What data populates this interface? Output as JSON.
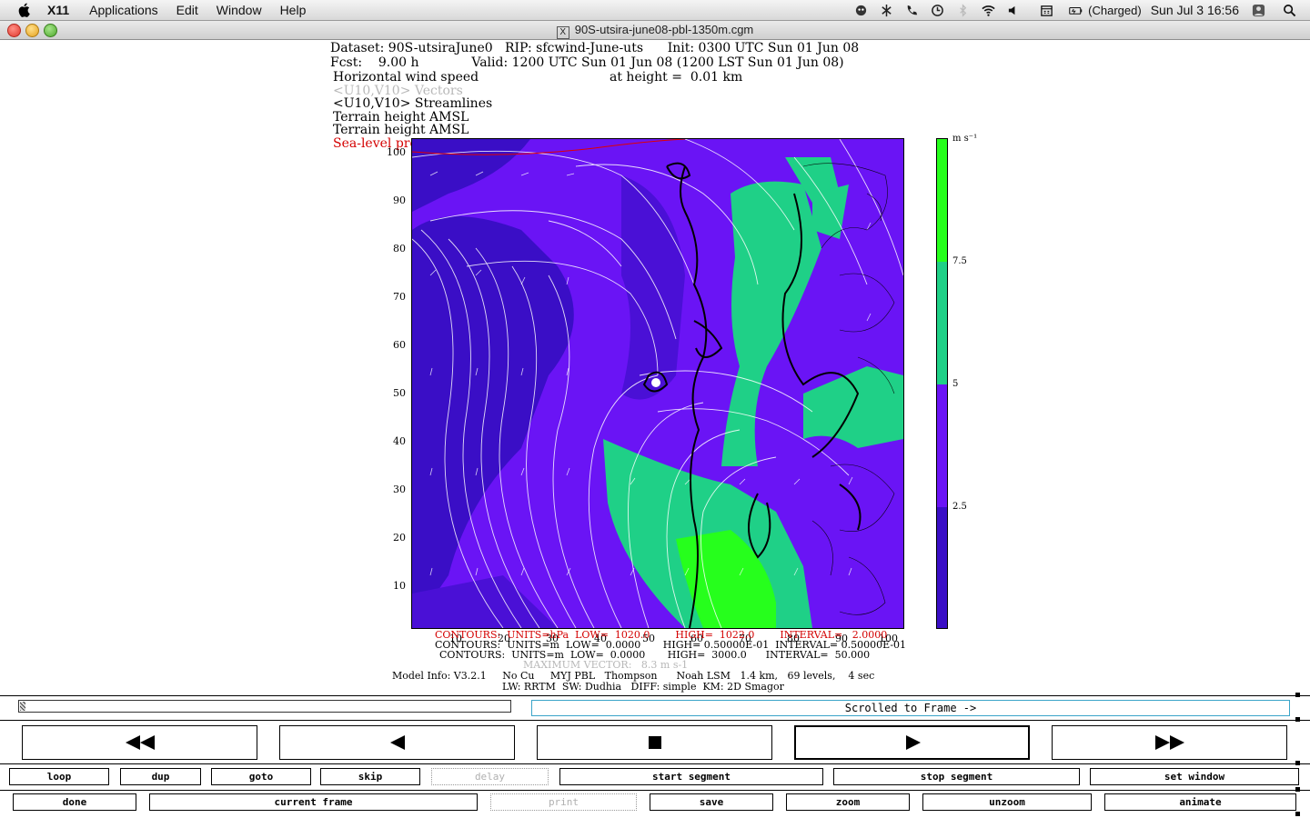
{
  "menubar": {
    "app_name": "X11",
    "items": [
      "Applications",
      "Edit",
      "Window",
      "Help"
    ],
    "battery_text": "(Charged)",
    "clock": "Sun Jul 3  16:56"
  },
  "window": {
    "title": "90S-utsira-june08-pbl-1350m.cgm"
  },
  "plot": {
    "header": {
      "dataset": "Dataset: 90S-utsiraJune0   RIP: sfcwind-June-uts      Init: 0300 UTC Sun 01 Jun 08",
      "fcst": "Fcst:    9.00 h             Valid: 1200 UTC Sun 01 Jun 08 (1200 LST Sun 01 Jun 08)",
      "field1": "Horizontal wind speed",
      "height": "at height =  0.01 km",
      "field2": "<U10,V10> Vectors",
      "field3": "<U10,V10> Streamlines",
      "field4": "Terrain height AMSL",
      "field5": "Terrain height AMSL",
      "field6": "Sea-level pressure"
    },
    "y_ticks": [
      "100",
      "90",
      "80",
      "70",
      "60",
      "50",
      "40",
      "30",
      "20",
      "10"
    ],
    "x_ticks": [
      "10",
      "20",
      "30",
      "40",
      "50",
      "60",
      "70",
      "80",
      "90",
      "100"
    ],
    "colorbar": {
      "units": "m s⁻¹",
      "labels": [
        "7.5",
        "5",
        "2.5"
      ],
      "colors": [
        "#26ff1c",
        "#1fd087",
        "#6a14f5",
        "#3a0ec6"
      ]
    },
    "footer": {
      "contours1": "CONTOURS:  UNITS=hPa  LOW=  1020.0        HIGH=  1022.0        INTERVAL=   2.0000",
      "contours2": "CONTOURS:  UNITS=m  LOW=  0.0000       HIGH= 0.50000E-01  INTERVAL= 0.50000E-01",
      "contours3": "CONTOURS:  UNITS=m  LOW=  0.0000       HIGH=  3000.0      INTERVAL=  50.000",
      "max_vector": "MAXIMUM VECTOR:   8.3 m s-1",
      "model_info": "Model Info: V3.2.1     No Cu     MYJ PBL   Thompson      Noah LSM   1.4 km,   69 levels,    4 sec",
      "model_info2": "LW: RRTM  SW: Dudhia   DIFF: simple  KM: 2D Smagor"
    }
  },
  "controls": {
    "frame_status": "Scrolled to Frame ->",
    "row1": [
      "loop",
      "dup",
      "goto",
      "skip",
      "delay",
      "start segment",
      "stop segment",
      "set window"
    ],
    "row2": [
      "done",
      "current frame",
      "print",
      "save",
      "zoom",
      "unzoom",
      "animate"
    ]
  }
}
